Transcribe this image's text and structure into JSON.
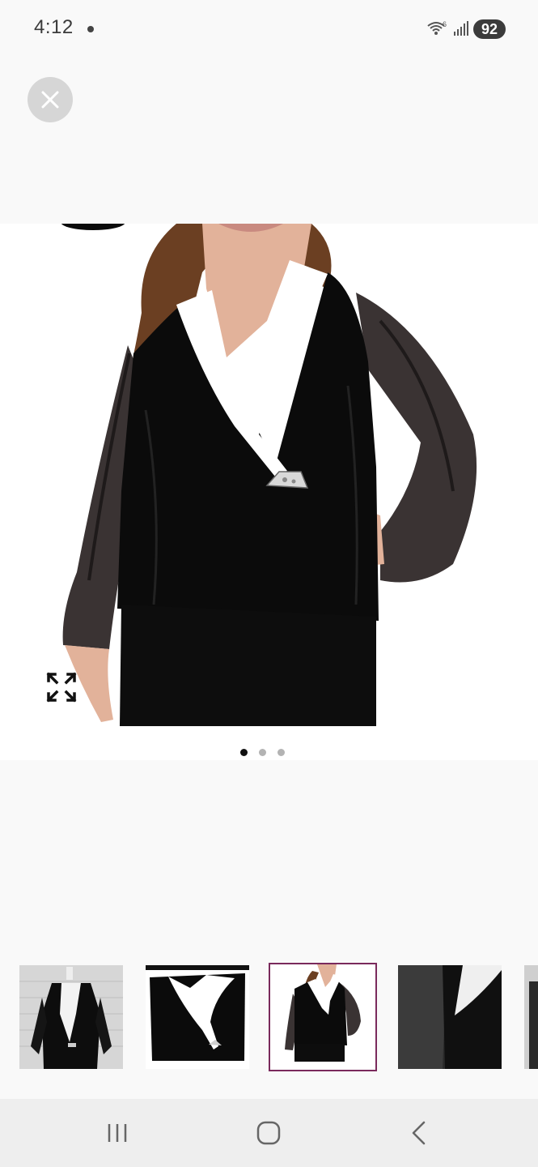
{
  "status_bar": {
    "time": "4:12",
    "battery": "92",
    "icons": [
      "wifi-icon",
      "signal-icon"
    ]
  },
  "close_button": {
    "icon": "close-icon"
  },
  "gallery": {
    "page_count": 3,
    "active_page": 1,
    "expand_icon": "expand-icon"
  },
  "thumbnails": {
    "count": 5,
    "selected_index": 3
  },
  "nav_bar": {
    "icons": [
      "recents-icon",
      "home-icon",
      "back-icon"
    ]
  },
  "colors": {
    "selected_border": "#7a2a5c",
    "garment": "#0b0b0b",
    "collar": "#ffffff"
  }
}
